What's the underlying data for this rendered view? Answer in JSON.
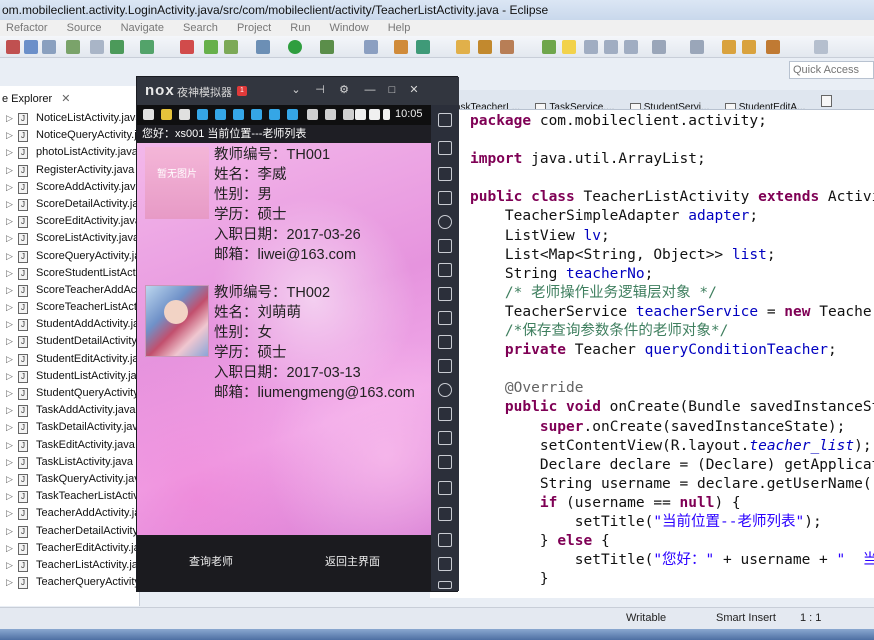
{
  "window": {
    "title": "om.mobileclient.activity.LoginActivity.java/src/com/mobileclient/activity/TeacherListActivity.java - Eclipse"
  },
  "menu": [
    "Refactor",
    "Source",
    "Navigate",
    "Search",
    "Project",
    "Run",
    "Window",
    "Help"
  ],
  "quick_access": {
    "placeholder": "Quick Access"
  },
  "explorer": {
    "tab_label": "e Explorer",
    "files": [
      "NoticeListActivity.java",
      "NoticeQueryActivity.java",
      "photoListActivity.java",
      "RegisterActivity.java",
      "ScoreAddActivity.java",
      "ScoreDetailActivity.java",
      "ScoreEditActivity.java",
      "ScoreListActivity.java",
      "ScoreQueryActivity.java",
      "ScoreStudentListActivity.java",
      "ScoreTeacherAddActivity.java",
      "ScoreTeacherListActivity.java",
      "StudentAddActivity.java",
      "StudentDetailActivity.java",
      "StudentEditActivity.java",
      "StudentListActivity.java",
      "StudentQueryActivity.java",
      "TaskAddActivity.java",
      "TaskDetailActivity.java",
      "TaskEditActivity.java",
      "TaskListActivity.java",
      "TaskQueryActivity.java",
      "TaskTeacherListActivity.java",
      "TeacherAddActivity.java",
      "TeacherDetailActivity.java",
      "TeacherEditActivity.java",
      "TeacherListActivity.java",
      "TeacherQueryActivity.java"
    ]
  },
  "editor": {
    "tabs": [
      "TaskTeacherL...",
      "TaskService....",
      "StudentServi...",
      "StudentEditA...",
      ""
    ],
    "code": {
      "l1_kw": "package",
      "l1": " com.mobileclient.activity;",
      "l2_kw": "import",
      "l2": " java.util.ArrayList;",
      "l3_kw1": "public class",
      "l3_a": " TeacherListActivity ",
      "l3_kw2": "extends",
      "l3_b": " Activi",
      "l4_a": "    TeacherSimpleAdapter ",
      "l4_f": "adapter",
      "l4_b": ";",
      "l5_a": "    ListView ",
      "l5_f": "lv",
      "l5_b": ";",
      "l6_a": "    List<Map<String, Object>> ",
      "l6_f": "list",
      "l6_b": ";",
      "l7_a": "    String ",
      "l7_f": "teacherNo",
      "l7_b": ";",
      "l8_c": "    /* 老师操作业务逻辑层对象 */",
      "l9_a": "    TeacherService ",
      "l9_f": "teacherService",
      "l9_b": " = ",
      "l9_kw": "new",
      "l9_c": " Teacher",
      "l10_c": "    /*保存查询参数条件的老师对象*/",
      "l11_kw": "    private",
      "l11_a": " Teacher ",
      "l11_f": "queryConditionTeacher",
      "l11_b": ";",
      "l12_ann": "    @Override",
      "l13_kw": "    public void",
      "l13_a": " onCreate(Bundle savedInstanceSt",
      "l14_kw": "        super",
      "l14_a": ".onCreate(savedInstanceState);",
      "l15_a": "        setContentView(R.layout.",
      "l15_f": "teacher_list",
      "l15_b": ");",
      "l16_a": "        Declare declare = (Declare) getApplicat",
      "l17_a": "        String username = declare.getUserName()",
      "l18_kw": "        if",
      "l18_a": " (username == ",
      "l18_kw2": "null",
      "l18_b": ") {",
      "l19_a": "            setTitle(",
      "l19_s": "\"当前位置--老师列表\"",
      "l19_b": ");",
      "l20_a": "        } ",
      "l20_kw": "else",
      "l20_b": " {",
      "l21_a": "            setTitle(",
      "l21_s": "\"您好：\"",
      "l21_b": " + username + ",
      "l21_s2": "\"  当",
      "l22_a": "        }"
    }
  },
  "status": {
    "mode": "Writable",
    "insert": "Smart Insert",
    "position": "1 : 1"
  },
  "emulator": {
    "logo": "nox",
    "name": "夜神模拟器",
    "badge": "1",
    "clock": "10:05",
    "header": "您好：xs001  当前位置---老师列表",
    "teachers": [
      {
        "photo_text": "暂无图片",
        "no": "教师编号：TH001",
        "name": "姓名：李威",
        "sex": "性别：男",
        "edu": "学历：硕士",
        "date": "入职日期：2017-03-26",
        "email": "邮箱：liwei@163.com"
      },
      {
        "photo_text": "",
        "no": "教师编号：TH002",
        "name": "姓名：刘萌萌",
        "sex": "性别：女",
        "edu": "学历：硕士",
        "date": "入职日期：2017-03-13",
        "email": "邮箱：liumengmeng@163.com"
      }
    ],
    "buttons": {
      "query": "查询老师",
      "home": "返回主界面"
    }
  },
  "colors": {
    "keyword": "#7f0055",
    "field": "#0000c0",
    "comment": "#3f7f5f",
    "string": "#2a00ff",
    "app_bg": "#e694de"
  }
}
